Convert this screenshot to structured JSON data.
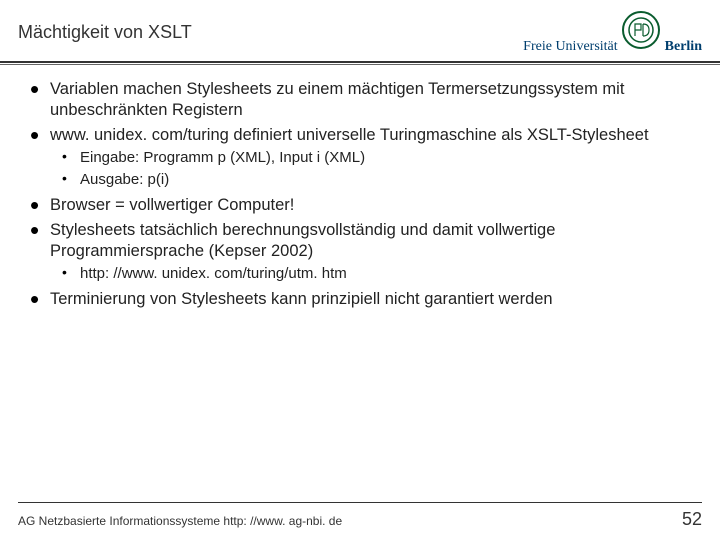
{
  "header": {
    "title": "Mächtigkeit von XSLT",
    "logo_light": "Freie Universität",
    "logo_bold": "Berlin"
  },
  "bullets": {
    "b1": "Variablen machen Stylesheets zu einem mächtigen Termersetzungssystem mit unbeschränkten Registern",
    "b2": "www. unidex. com/turing definiert universelle Turingmaschine als XSLT-Stylesheet",
    "b2_sub1": "Eingabe:  Programm p (XML), Input i (XML)",
    "b2_sub2": "Ausgabe: p(i)",
    "b3": "Browser = vollwertiger Computer!",
    "b4": "Stylesheets tatsächlich berechnungsvollständig und damit vollwertige Programmiersprache (Kepser 2002)",
    "b4_sub1": "http: //www. unidex. com/turing/utm. htm",
    "b5": "Terminierung von Stylesheets kann prinzipiell nicht garantiert werden"
  },
  "footer": {
    "text": "AG Netzbasierte Informationssysteme http: //www. ag-nbi. de",
    "page": "52"
  }
}
